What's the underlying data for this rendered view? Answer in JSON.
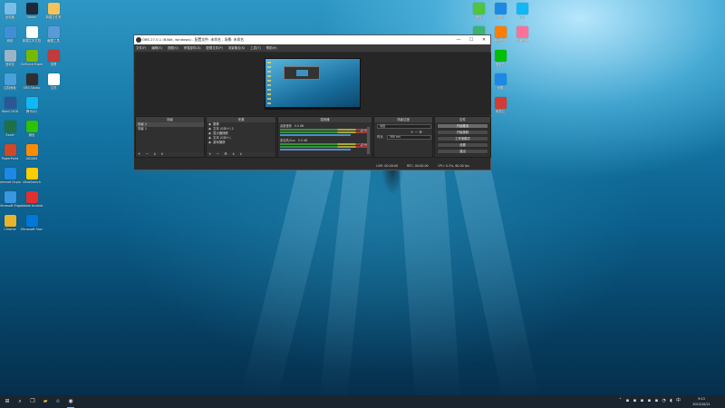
{
  "desktop": {
    "icons_left": [
      {
        "label": "此电脑",
        "color": "#7bbde6"
      },
      {
        "label": "网络",
        "color": "#3f8fd6"
      },
      {
        "label": "回收站",
        "color": "#9ab4c8"
      },
      {
        "label": "控制面板",
        "color": "#4aa0d8"
      },
      {
        "label": "Word 2016",
        "color": "#2b5797"
      },
      {
        "label": "Excel",
        "color": "#1e7145"
      },
      {
        "label": "PowerPoint",
        "color": "#d24726"
      },
      {
        "label": "Internet Explorer",
        "color": "#1e88e5"
      },
      {
        "label": "Microsoft Edge",
        "color": "#3a96dd"
      },
      {
        "label": "Chrome",
        "color": "#e9b42a"
      },
      {
        "label": "Steam",
        "color": "#1b2838"
      },
      {
        "label": "新建文本文档",
        "color": "#ffffff"
      },
      {
        "label": "GeForce Experience",
        "color": "#76b900"
      },
      {
        "label": "OBS Studio",
        "color": "#302e31"
      },
      {
        "label": "腾讯QQ",
        "color": "#12b7f5"
      },
      {
        "label": "微信",
        "color": "#2dc100"
      },
      {
        "label": "AIDA64",
        "color": "#ff8c00"
      },
      {
        "label": "UltraSearch",
        "color": "#ffcc00"
      },
      {
        "label": "Adobe Acrobat",
        "color": "#e02f2f"
      },
      {
        "label": "Microsoft Store",
        "color": "#0078d7"
      },
      {
        "label": "新建文件夹",
        "color": "#f4c45a"
      },
      {
        "label": "截图工具",
        "color": "#5a9ad6"
      },
      {
        "label": "录屏",
        "color": "#c23b3b"
      },
      {
        "label": "文档",
        "color": "#ffffff"
      }
    ],
    "icons_right": [
      {
        "label": "微信",
        "color": "#4ec53b"
      },
      {
        "label": "360安全",
        "color": "#3cb371"
      },
      {
        "label": "迅雷",
        "color": "#1e90ff"
      },
      {
        "label": "百度网盘",
        "color": "#2f8fe8"
      },
      {
        "label": "QQ音乐",
        "color": "#f4c22b"
      },
      {
        "label": "酷狗",
        "color": "#1e88e5"
      },
      {
        "label": "腾讯视频",
        "color": "#ff7d00"
      },
      {
        "label": "爱奇艺",
        "color": "#00be06"
      },
      {
        "label": "优酷",
        "color": "#1e88e5"
      },
      {
        "label": "网易云",
        "color": "#d43c33"
      },
      {
        "label": "QQ",
        "color": "#12b7f5"
      },
      {
        "label": "哔哩哔哩",
        "color": "#fb7299"
      }
    ]
  },
  "obs": {
    "title": "OBS 27.0.1 (64bit, windows) - 配置文件: 未命名 - 场景: 未命名",
    "menu": [
      "文件(F)",
      "编辑(E)",
      "视图(V)",
      "停靠部件(D)",
      "配置文件(P)",
      "场景集合(S)",
      "工具(T)",
      "帮助(H)"
    ],
    "window_buttons": {
      "minimize": "—",
      "maximize": "☐",
      "close": "✕"
    },
    "docks": {
      "scenes": {
        "title": "场景",
        "items": [
          "场景 2",
          "场景 1"
        ],
        "footer": "+ − ∧ ∨"
      },
      "sources": {
        "title": "来源",
        "items": [
          "图像",
          "文本 (GDI+) 2",
          "显示器捕获",
          "文本 (GDI+)",
          "游戏捕获"
        ],
        "footer": "+ − ⚙ ∧ ∨"
      },
      "mixer": {
        "title": "混音器",
        "channels": [
          {
            "name": "桌面音频",
            "db": "0.0 dB"
          },
          {
            "name": "麦克风/Aux",
            "db": "0.0 dB"
          }
        ]
      },
      "transitions": {
        "title": "场景过渡",
        "type": "淡出",
        "duration_label": "时长",
        "duration_value": "300 ms"
      },
      "controls": {
        "title": "控件",
        "buttons": [
          "开始推流",
          "开始录制",
          "工作室模式",
          "设置",
          "退出"
        ]
      }
    },
    "status": {
      "live": "LIVE: 00:00:00",
      "rec": "REC: 00:00:00",
      "cpu": "CPU: 0.3%, 60.00 fps"
    }
  },
  "taskbar": {
    "start_icon": "windows-icon",
    "items": [
      "search-icon",
      "task-view-icon",
      "file-explorer-icon",
      "edge-icon",
      "store-icon",
      "obs-icon"
    ],
    "time": "9:13",
    "date": "2022/10/21"
  }
}
